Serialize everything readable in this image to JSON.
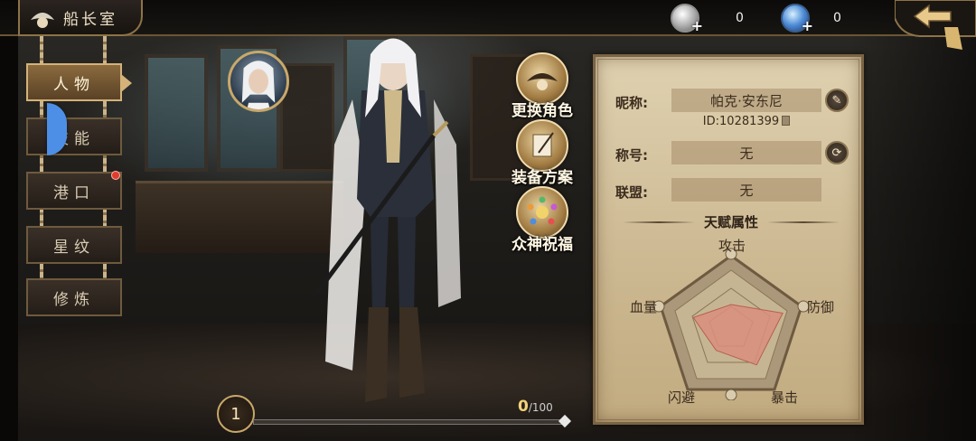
{
  "header": {
    "title": "船长室"
  },
  "resources": [
    {
      "name": "silver-coin",
      "value": "0"
    },
    {
      "name": "gem",
      "value": "0"
    }
  ],
  "menu": [
    {
      "label": "人物",
      "active": true
    },
    {
      "label": "技能",
      "active": false
    },
    {
      "label": "港口",
      "active": false,
      "badge": true
    },
    {
      "label": "星纹",
      "active": false
    },
    {
      "label": "修炼",
      "active": false
    }
  ],
  "actions": {
    "change_role": "更换角色",
    "equipment_plan": "装备方案",
    "gods_blessing": "众神祝福"
  },
  "level": {
    "value": "1",
    "xp_current": "0",
    "xp_total": "/100",
    "progress": 0
  },
  "profile": {
    "nickname_label": "昵称:",
    "nickname": "帕克·安东尼",
    "id_text": "ID:10281399",
    "title_label": "称号:",
    "title_value": "无",
    "alliance_label": "联盟:",
    "alliance_value": "无"
  },
  "talent": {
    "section_title": "天赋属性",
    "stats": [
      "攻击",
      "防御",
      "暴击",
      "闪避",
      "血量"
    ],
    "values": [
      0.35,
      0.75,
      0.6,
      0.35,
      0.55
    ]
  },
  "colors": {
    "accent": "#c9a86a",
    "radar_fill": "#d98f7e",
    "active_tab": "#8b6a3e"
  }
}
